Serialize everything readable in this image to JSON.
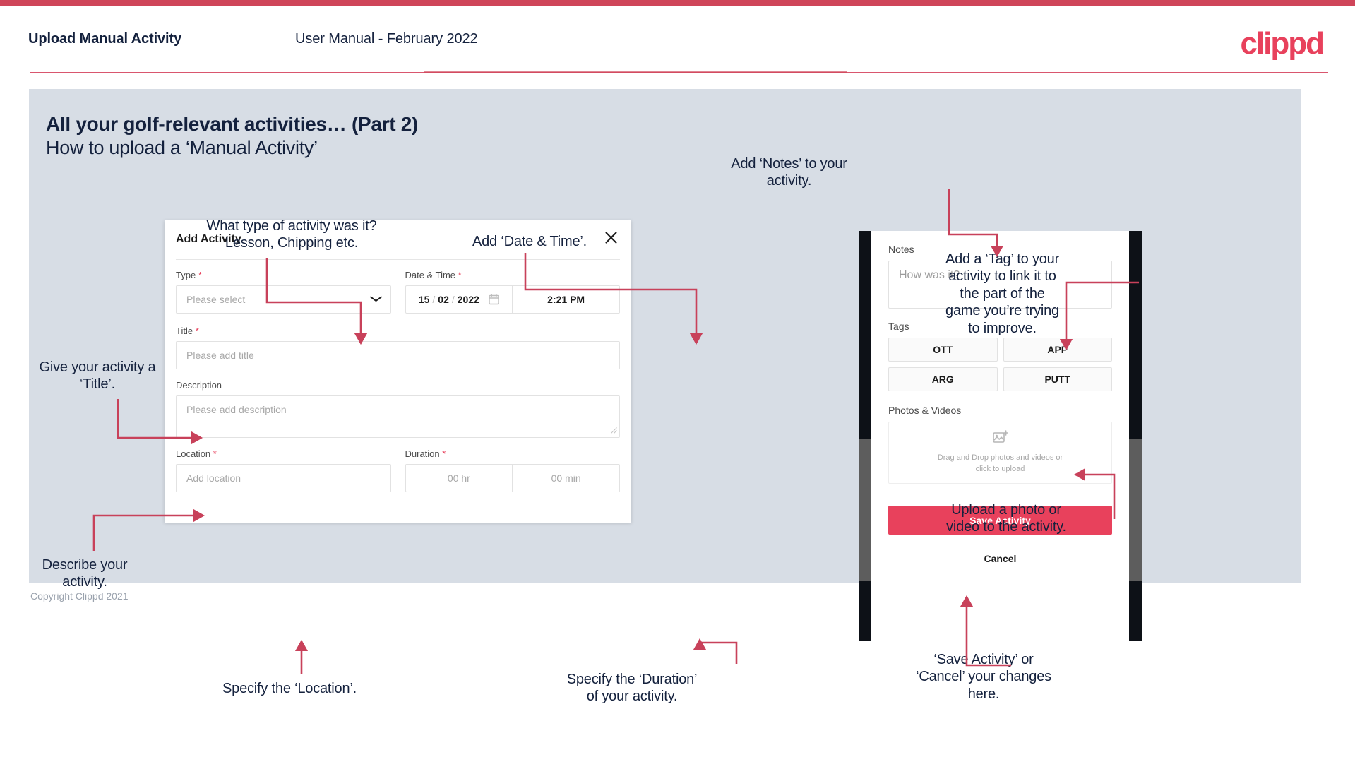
{
  "header": {
    "title": "Upload Manual Activity",
    "subtitle": "User Manual - February 2022",
    "logo": "clippd"
  },
  "slide": {
    "title": "All your golf-relevant activities… (Part 2)",
    "subtitle": "How to upload a ‘Manual Activity’"
  },
  "footer": {
    "copyright": "Copyright Clippd 2021"
  },
  "dialog": {
    "title": "Add Activity",
    "close_icon": "close-icon",
    "type": {
      "label": "Type",
      "required": "*",
      "placeholder": "Please select",
      "chevron": "⌄"
    },
    "datetime": {
      "label": "Date & Time",
      "required": "*",
      "day": "15",
      "month": "02",
      "year": "2022",
      "sep": "/",
      "time": "2:21 PM",
      "calendar_icon": "calendar-icon"
    },
    "title_field": {
      "label": "Title",
      "required": "*",
      "placeholder": "Please add title"
    },
    "description": {
      "label": "Description",
      "placeholder": "Please add description"
    },
    "location": {
      "label": "Location",
      "required": "*",
      "placeholder": "Add location"
    },
    "duration": {
      "label": "Duration",
      "required": "*",
      "hours": "00 hr",
      "minutes": "00 min"
    }
  },
  "phone": {
    "notes": {
      "label": "Notes",
      "placeholder": "How was it?"
    },
    "tags": {
      "label": "Tags",
      "items": [
        "OTT",
        "APP",
        "ARG",
        "PUTT"
      ]
    },
    "photos": {
      "label": "Photos & Videos",
      "dropzone_line1": "Drag and Drop photos and videos or",
      "dropzone_line2": "click to upload",
      "icon": "image-add-icon"
    },
    "save_label": "Save Activity",
    "cancel_label": "Cancel"
  },
  "annotations": {
    "type": "What type of activity was it?\nLesson, Chipping etc.",
    "datetime": "Add ‘Date & Time’.",
    "title": "Give your activity a\n‘Title’.",
    "description": "Describe your\nactivity.",
    "location": "Specify the ‘Location’.",
    "duration": "Specify the ‘Duration’\nof your activity.",
    "notes": "Add ‘Notes’ to your\nactivity.",
    "tags": "Add a ‘Tag’ to your\nactivity to link it to\nthe part of the\ngame you’re trying\nto improve.",
    "upload": "Upload a photo or\nvideo to the activity.",
    "save": "‘Save Activity’ or\n‘Cancel’ your changes\nhere."
  },
  "colors": {
    "brand_pink": "#e8415c",
    "arrow_red": "#c8415a",
    "slide_bg": "#d7dde5",
    "navy": "#14213d"
  }
}
